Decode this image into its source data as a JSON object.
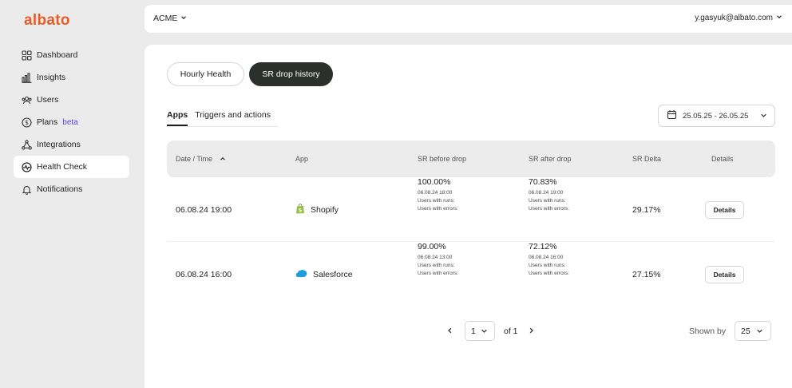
{
  "brand": {
    "logo": "albato",
    "color": "#ea5c26"
  },
  "sidebar": {
    "items": [
      {
        "label": "Dashboard",
        "icon": "grid-icon"
      },
      {
        "label": "Insights",
        "icon": "bar-chart-icon"
      },
      {
        "label": "Users",
        "icon": "users-icon"
      },
      {
        "label": "Plans",
        "icon": "dollar-icon",
        "badge": "beta"
      },
      {
        "label": "Integrations",
        "icon": "integrations-icon"
      },
      {
        "label": "Health Check",
        "icon": "pulse-icon",
        "active": true
      },
      {
        "label": "Notifications",
        "icon": "bell-icon"
      }
    ]
  },
  "topbar": {
    "workspace": "ACME",
    "account": "y.gasyuk@albato.com"
  },
  "tabs": {
    "hourly": "Hourly Health",
    "srdrop": "SR drop history"
  },
  "subtabs": {
    "apps": "Apps",
    "triggers": "Triggers and actions"
  },
  "date_range": "25.05.25 - 26.05.25",
  "table": {
    "headers": {
      "date": "Date / Time",
      "app": "App",
      "before": "SR before drop",
      "after": "SR after drop",
      "delta": "SR Delta",
      "details": "Details"
    },
    "rows": [
      {
        "date": "06.08.24 19:00",
        "app": "Shopify",
        "before": {
          "value": "100.00%",
          "time": "06.08.24 18:00",
          "runs": "Users with runs:",
          "errors": "Users with errors:"
        },
        "after": {
          "value": "70.83%",
          "time": "06.08.24 19:00",
          "runs": "Users with runs:",
          "errors": "Users with errors:"
        },
        "delta": "29.17%",
        "details": "Details"
      },
      {
        "date": "06.08.24 16:00",
        "app": "Salesforce",
        "before": {
          "value": "99.00%",
          "time": "06.08.24 13:00",
          "runs": "Users with runs:",
          "errors": "Users with errors:"
        },
        "after": {
          "value": "72.12%",
          "time": "06.08.24 16:00",
          "runs": "Users with runs:",
          "errors": "Users with errors:"
        },
        "delta": "27.15%",
        "details": "Details"
      }
    ]
  },
  "pagination": {
    "page": "1",
    "of": "of 1",
    "shown_label": "Shown by",
    "shown_value": "25"
  }
}
